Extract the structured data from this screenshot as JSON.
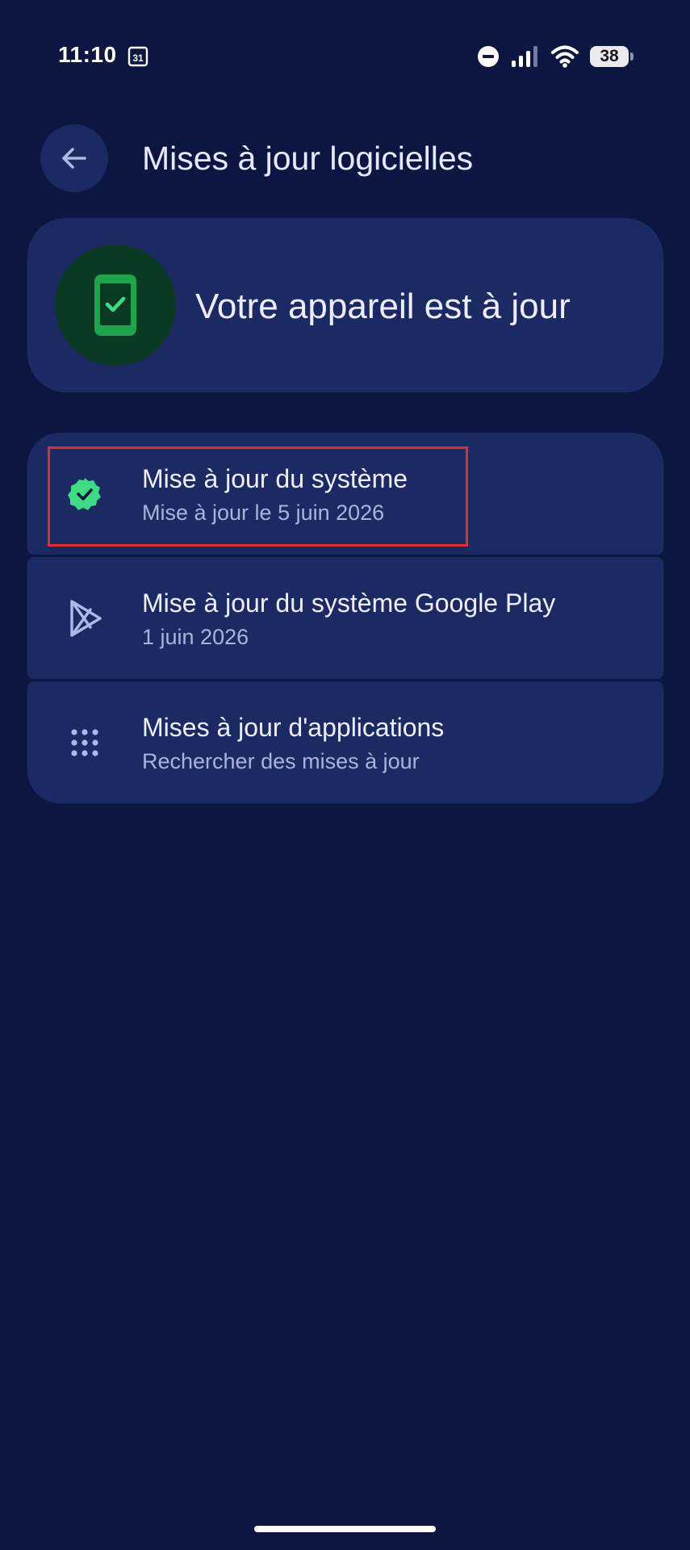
{
  "status_bar": {
    "time": "11:10",
    "calendar_day": "31",
    "battery": "38"
  },
  "header": {
    "title": "Mises à jour logicielles"
  },
  "status_card": {
    "message": "Votre appareil est à jour"
  },
  "updates": [
    {
      "title": "Mise à jour du système",
      "subtitle": "Mise à jour le 5 juin 2026",
      "icon": "verified-check-icon"
    },
    {
      "title": "Mise à jour du système Google Play",
      "subtitle": "1 juin 2026",
      "icon": "play-store-icon"
    },
    {
      "title": "Mises à jour d'applications",
      "subtitle": "Rechercher des mises à jour",
      "icon": "apps-grid-icon"
    }
  ],
  "colors": {
    "background": "#0c1641",
    "card": "#1c2a63",
    "accent_green": "#3ddc84",
    "highlight": "#e03028"
  }
}
